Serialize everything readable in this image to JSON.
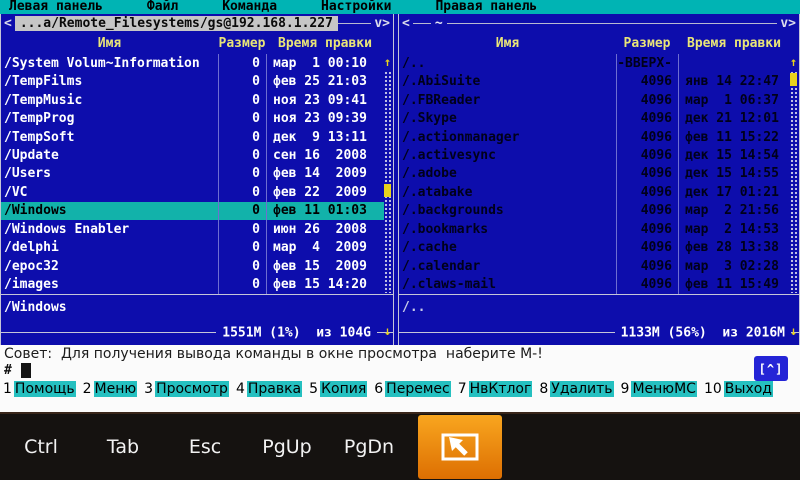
{
  "menubar": {
    "items": [
      "Левая панель",
      "Файл",
      "Команда",
      "Настройки",
      "Правая панель"
    ]
  },
  "left_panel": {
    "nav_left": "<",
    "nav_right": "v>",
    "path_display": "...a/Remote_Filesystems/gs@192.168.1.227",
    "columns": {
      "name": "Имя",
      "size": "Размер",
      "mtime": "Время правки"
    },
    "rows": [
      {
        "name": "/System Volum~Information",
        "size": "0",
        "mtime": "мар  1 00:10",
        "selected": false
      },
      {
        "name": "/TempFilms",
        "size": "0",
        "mtime": "фев 25 21:03",
        "selected": false
      },
      {
        "name": "/TempMusic",
        "size": "0",
        "mtime": "ноя 23 09:41",
        "selected": false
      },
      {
        "name": "/TempProg",
        "size": "0",
        "mtime": "ноя 23 09:39",
        "selected": false
      },
      {
        "name": "/TempSoft",
        "size": "0",
        "mtime": "дек  9 13:11",
        "selected": false
      },
      {
        "name": "/Update",
        "size": "0",
        "mtime": "сен 16  2008",
        "selected": false
      },
      {
        "name": "/Users",
        "size": "0",
        "mtime": "фев 14  2009",
        "selected": false
      },
      {
        "name": "/VC",
        "size": "0",
        "mtime": "фев 22  2009",
        "selected": false
      },
      {
        "name": "/Windows",
        "size": "0",
        "mtime": "фев 11 01:03",
        "selected": true
      },
      {
        "name": "/Windows Enabler",
        "size": "0",
        "mtime": "июн 26  2008",
        "selected": false
      },
      {
        "name": "/delphi",
        "size": "0",
        "mtime": "мар  4  2009",
        "selected": false
      },
      {
        "name": "/epoc32",
        "size": "0",
        "mtime": "фев 15  2009",
        "selected": false
      },
      {
        "name": "/images",
        "size": "0",
        "mtime": "фев 15 14:20",
        "selected": false
      }
    ],
    "mini_status": "/Windows",
    "free_space": "1551M (1%)  из 104G"
  },
  "right_panel": {
    "nav_left": "<",
    "nav_right": "v>",
    "path_display": "~",
    "columns": {
      "name": "Имя",
      "size": "Размер",
      "mtime": "Время правки"
    },
    "rows": [
      {
        "name": "/..",
        "size": "-ВВЕРХ-",
        "mtime": "",
        "selected": false
      },
      {
        "name": "/.AbiSuite",
        "size": "4096",
        "mtime": "янв 14 22:47",
        "selected": false
      },
      {
        "name": "/.FBReader",
        "size": "4096",
        "mtime": "мар  1 06:37",
        "selected": false
      },
      {
        "name": "/.Skype",
        "size": "4096",
        "mtime": "дек 21 12:01",
        "selected": false
      },
      {
        "name": "/.actionmanager",
        "size": "4096",
        "mtime": "фев 11 15:22",
        "selected": false
      },
      {
        "name": "/.activesync",
        "size": "4096",
        "mtime": "дек 15 14:54",
        "selected": false
      },
      {
        "name": "/.adobe",
        "size": "4096",
        "mtime": "дек 15 14:55",
        "selected": false
      },
      {
        "name": "/.atabake",
        "size": "4096",
        "mtime": "дек 17 01:21",
        "selected": false
      },
      {
        "name": "/.backgrounds",
        "size": "4096",
        "mtime": "мар  2 21:56",
        "selected": false
      },
      {
        "name": "/.bookmarks",
        "size": "4096",
        "mtime": "мар  2 14:53",
        "selected": false
      },
      {
        "name": "/.cache",
        "size": "4096",
        "mtime": "фев 28 13:38",
        "selected": false
      },
      {
        "name": "/.calendar",
        "size": "4096",
        "mtime": "мар  3 02:28",
        "selected": false
      },
      {
        "name": "/.claws-mail",
        "size": "4096",
        "mtime": "фев 11 15:49",
        "selected": false
      }
    ],
    "mini_status": "/..",
    "free_space": "1133M (56%)  из 2016M"
  },
  "hint": "Совет:  Для получения вывода команды в окне просмотра  наберите M-!",
  "command_line": {
    "prompt": "#"
  },
  "sip_indicator": "[^]",
  "fkeys": [
    {
      "num": "1",
      "label": "Помощь"
    },
    {
      "num": "2",
      "label": "Меню"
    },
    {
      "num": "3",
      "label": "Просмотр"
    },
    {
      "num": "4",
      "label": "Правка"
    },
    {
      "num": "5",
      "label": "Копия"
    },
    {
      "num": "6",
      "label": "Перемес"
    },
    {
      "num": "7",
      "label": "НвКтлог"
    },
    {
      "num": "8",
      "label": "Удалить"
    },
    {
      "num": "9",
      "label": "МенюМС"
    },
    {
      "num": "10",
      "label": "Выход"
    }
  ],
  "toolbar": {
    "keys": [
      "Ctrl",
      "Tab",
      "Esc",
      "PgUp",
      "PgDn"
    ]
  },
  "colors": {
    "panel_bg": "#0d0dac",
    "menubar_bg": "#00b4b4",
    "selection_bg": "#12b2aa",
    "header_yellow": "#e9e578",
    "scrollbar_yellow": "#e8d21c",
    "fkey_label_bg": "#25c0c0",
    "toolbar_bg": "#151210",
    "orange_button": "#ef8a10",
    "sip_blue": "#2424d6"
  }
}
